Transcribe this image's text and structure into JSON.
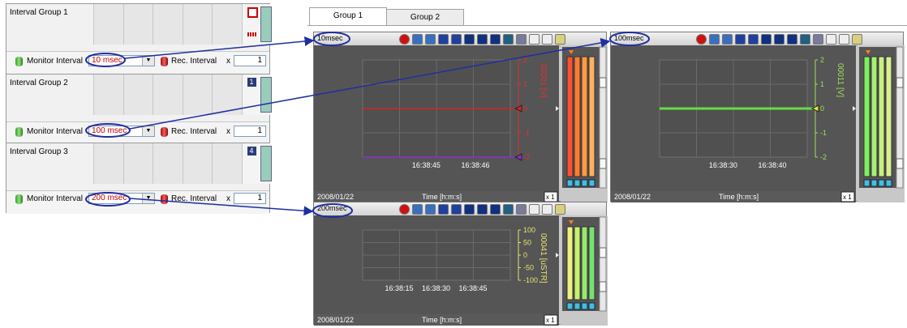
{
  "left_groups": [
    {
      "title": "Interval Group 1",
      "monitor_label": "Monitor Interval",
      "monitor_value": "10 msec",
      "rec_label": "Rec. Interval",
      "rec_mult": "x",
      "rec_value": "1"
    },
    {
      "title": "Interval Group 2",
      "monitor_label": "Monitor Interval",
      "monitor_value": "100 msec",
      "rec_label": "Rec. Interval",
      "rec_mult": "x",
      "rec_value": "1"
    },
    {
      "title": "Interval Group 3",
      "monitor_label": "Monitor Interval",
      "monitor_value": "200 msec",
      "rec_label": "Rec. Interval",
      "rec_mult": "x",
      "rec_value": "1"
    }
  ],
  "tabs": [
    {
      "label": "Group 1"
    },
    {
      "label": "Group 2"
    }
  ],
  "charts": [
    {
      "interval": "10msec",
      "date": "2008/01/22",
      "xlabel": "Time [h:m:s]",
      "xticks": [
        "16:38:45",
        "16:38:46"
      ],
      "channel": "00001 [V]",
      "yticks": [
        "2",
        "1",
        "0",
        "-1",
        "-2"
      ],
      "ylim": [
        -2,
        2
      ],
      "axis_color": "#e03030",
      "zoom": "x 1",
      "series": [
        {
          "color": "#e02020",
          "value": 0
        },
        {
          "color": "#8a30d0",
          "value": -2
        }
      ]
    },
    {
      "interval": "100msec",
      "date": "2008/01/22",
      "xlabel": "Time [h:m:s]",
      "xticks": [
        "16:38:30",
        "16:38:40"
      ],
      "channel": "00011 [V]",
      "yticks": [
        "2",
        "1",
        "0",
        "-1",
        "-2"
      ],
      "ylim": [
        -2,
        2
      ],
      "axis_color": "#9be05a",
      "zoom": "x 1",
      "series": [
        {
          "color": "#66dd44",
          "value": 0
        }
      ]
    },
    {
      "interval": "200msec",
      "date": "2008/01/22",
      "xlabel": "Time [h:m:s]",
      "xticks": [
        "16:38:15",
        "16:38:30",
        "16:38:45"
      ],
      "channel": "00041 [uSTR]",
      "yticks": [
        "100",
        "50",
        "0",
        "-50",
        "-100"
      ],
      "ylim": [
        -100,
        100
      ],
      "axis_color": "#e8e070",
      "zoom": "x 1",
      "series": []
    }
  ],
  "colors": {
    "highlight": "#1f2fa0",
    "interval_value": "#c00000"
  }
}
